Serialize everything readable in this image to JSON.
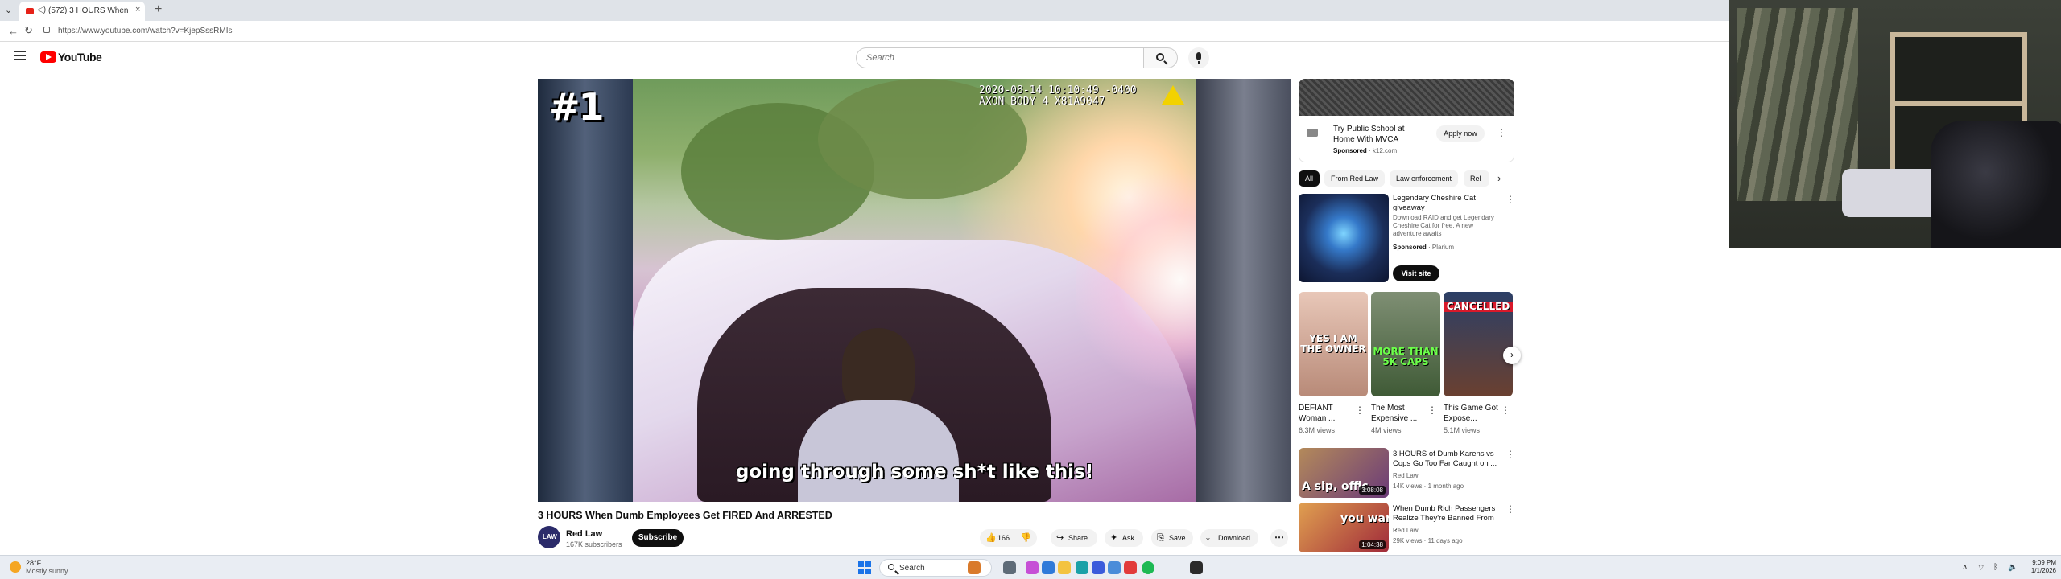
{
  "browser": {
    "tab_title": "(572) 3 HOURS When Dumb",
    "tab_close": "×",
    "new_tab": "+",
    "url": "https://www.youtube.com/watch?v=KjepSssRMIs"
  },
  "youtube": {
    "logo_text": "YouTube",
    "search_placeholder": "Search"
  },
  "player": {
    "rank_overlay": "#1",
    "bodycam_stamp": "2020-08-14 10:10:49 -0400\nAXON BODY 4 X81A9047",
    "caption": "going through some sh*t like this!"
  },
  "video": {
    "title": "3 HOURS When Dumb Employees Get FIRED And ARRESTED",
    "channel_name": "Red Law",
    "channel_avatar_text": "LAW",
    "subscribers": "167K subscribers",
    "subscribe_label": "Subscribe",
    "actions": {
      "likes": "166",
      "share": "Share",
      "ask": "Ask",
      "save": "Save",
      "download": "Download"
    }
  },
  "ad": {
    "title": "Try Public School at Home With MVCA",
    "sponsored": "Sponsored",
    "domain": "k12.com",
    "apply_label": "Apply now"
  },
  "chips": [
    "All",
    "From Red Law",
    "Law enforcement",
    "Rel"
  ],
  "promo": {
    "title": "Legendary Cheshire Cat giveaway",
    "description": "Download RAID and get Legendary Cheshire Cat for free. A new adventure awaits",
    "sponsored": "Sponsored",
    "advertiser": "Plarium",
    "cta": "Visit site"
  },
  "shorts": [
    {
      "title": "DEFIANT Woman ...",
      "views": "6.3M views",
      "overlay": "YES I AM THE OWNER",
      "color": "#d9b7a8"
    },
    {
      "title": "The Most Expensive ...",
      "views": "4M views",
      "overlay": "MORE THAN 5K CAPS",
      "color": "#5c7a4d"
    },
    {
      "title": "This Game Got Expose...",
      "views": "5.1M views",
      "overlay": "CANCELLED",
      "color": "#3a4b6e"
    }
  ],
  "related": [
    {
      "title": "3 HOURS of Dumb Karens vs Cops Go Too Far Caught on ...",
      "channel": "Red Law",
      "meta": "14K views · 1 month ago",
      "duration": "3:08:08",
      "overlay": "A sip, offic"
    },
    {
      "title": "When Dumb Rich Passengers Realize They're Banned From ...",
      "channel": "Red Law",
      "meta": "29K views · 11 days ago",
      "duration": "1:04:38",
      "overlay": "you want"
    }
  ],
  "taskbar": {
    "temperature": "28°F",
    "weather": "Mostly sunny",
    "search": "Search",
    "time": "9:09 PM",
    "date": "1/1/2026"
  },
  "colors": {
    "youtube_red": "#ff0000",
    "text_primary": "#0f0f0f",
    "text_secondary": "#606060",
    "chip_bg": "#f2f2f2"
  },
  "icons": [
    "menu-icon",
    "youtube-logo-icon",
    "search-icon",
    "mic-icon",
    "like-icon",
    "dislike-icon",
    "share-icon",
    "ask-icon",
    "save-icon",
    "download-icon",
    "more-icon",
    "chevron-right-icon",
    "windows-start-icon",
    "weather-icon"
  ]
}
